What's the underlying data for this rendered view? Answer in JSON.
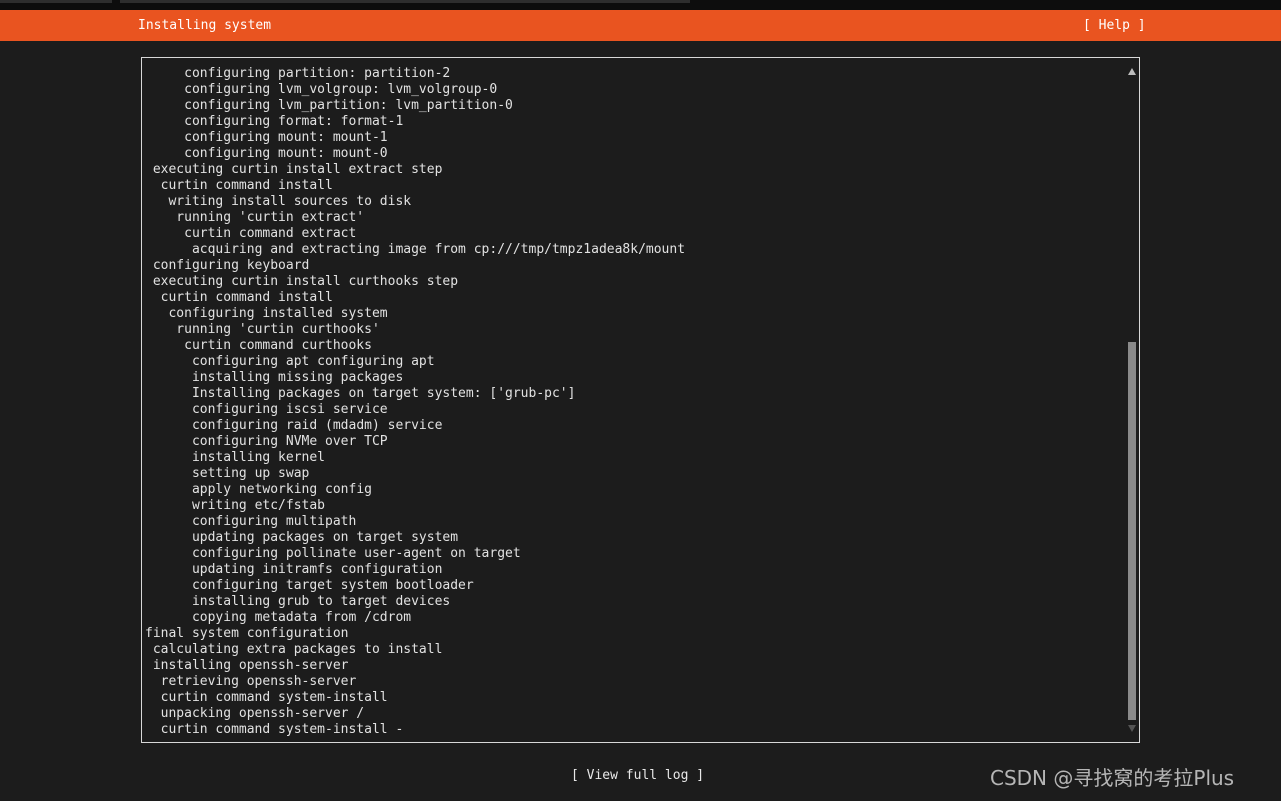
{
  "header": {
    "title": "Installing system",
    "help_label": "[ Help ]"
  },
  "log": {
    "lines": [
      {
        "indent": 5,
        "text": "configuring partition: partition-2"
      },
      {
        "indent": 5,
        "text": "configuring lvm_volgroup: lvm_volgroup-0"
      },
      {
        "indent": 5,
        "text": "configuring lvm_partition: lvm_partition-0"
      },
      {
        "indent": 5,
        "text": "configuring format: format-1"
      },
      {
        "indent": 5,
        "text": "configuring mount: mount-1"
      },
      {
        "indent": 5,
        "text": "configuring mount: mount-0"
      },
      {
        "indent": 1,
        "text": "executing curtin install extract step"
      },
      {
        "indent": 2,
        "text": "curtin command install"
      },
      {
        "indent": 3,
        "text": "writing install sources to disk"
      },
      {
        "indent": 4,
        "text": "running 'curtin extract'"
      },
      {
        "indent": 5,
        "text": "curtin command extract"
      },
      {
        "indent": 6,
        "text": "acquiring and extracting image from cp:///tmp/tmpz1adea8k/mount"
      },
      {
        "indent": 1,
        "text": "configuring keyboard"
      },
      {
        "indent": 1,
        "text": "executing curtin install curthooks step"
      },
      {
        "indent": 2,
        "text": "curtin command install"
      },
      {
        "indent": 3,
        "text": "configuring installed system"
      },
      {
        "indent": 4,
        "text": "running 'curtin curthooks'"
      },
      {
        "indent": 5,
        "text": "curtin command curthooks"
      },
      {
        "indent": 6,
        "text": "configuring apt configuring apt"
      },
      {
        "indent": 6,
        "text": "installing missing packages"
      },
      {
        "indent": 6,
        "text": "Installing packages on target system: ['grub-pc']"
      },
      {
        "indent": 6,
        "text": "configuring iscsi service"
      },
      {
        "indent": 6,
        "text": "configuring raid (mdadm) service"
      },
      {
        "indent": 6,
        "text": "configuring NVMe over TCP"
      },
      {
        "indent": 6,
        "text": "installing kernel"
      },
      {
        "indent": 6,
        "text": "setting up swap"
      },
      {
        "indent": 6,
        "text": "apply networking config"
      },
      {
        "indent": 6,
        "text": "writing etc/fstab"
      },
      {
        "indent": 6,
        "text": "configuring multipath"
      },
      {
        "indent": 6,
        "text": "updating packages on target system"
      },
      {
        "indent": 6,
        "text": "configuring pollinate user-agent on target"
      },
      {
        "indent": 6,
        "text": "updating initramfs configuration"
      },
      {
        "indent": 6,
        "text": "configuring target system bootloader"
      },
      {
        "indent": 6,
        "text": "installing grub to target devices"
      },
      {
        "indent": 6,
        "text": "copying metadata from /cdrom"
      },
      {
        "indent": 0,
        "text": "final system configuration"
      },
      {
        "indent": 1,
        "text": "calculating extra packages to install"
      },
      {
        "indent": 1,
        "text": "installing openssh-server"
      },
      {
        "indent": 2,
        "text": "retrieving openssh-server"
      },
      {
        "indent": 2,
        "text": "curtin command system-install"
      },
      {
        "indent": 2,
        "text": "unpacking openssh-server /"
      },
      {
        "indent": 2,
        "text": "curtin command system-install -"
      }
    ],
    "scroll_position": 0.41,
    "scroll_visible_fraction": 0.59
  },
  "footer": {
    "view_log_label": "[ View full log ]"
  },
  "watermark": {
    "text": "CSDN @寻找窝的考拉Plus"
  },
  "colors": {
    "accent": "#e95420",
    "background": "#1c1c1c",
    "text": "#e8e8e8"
  }
}
